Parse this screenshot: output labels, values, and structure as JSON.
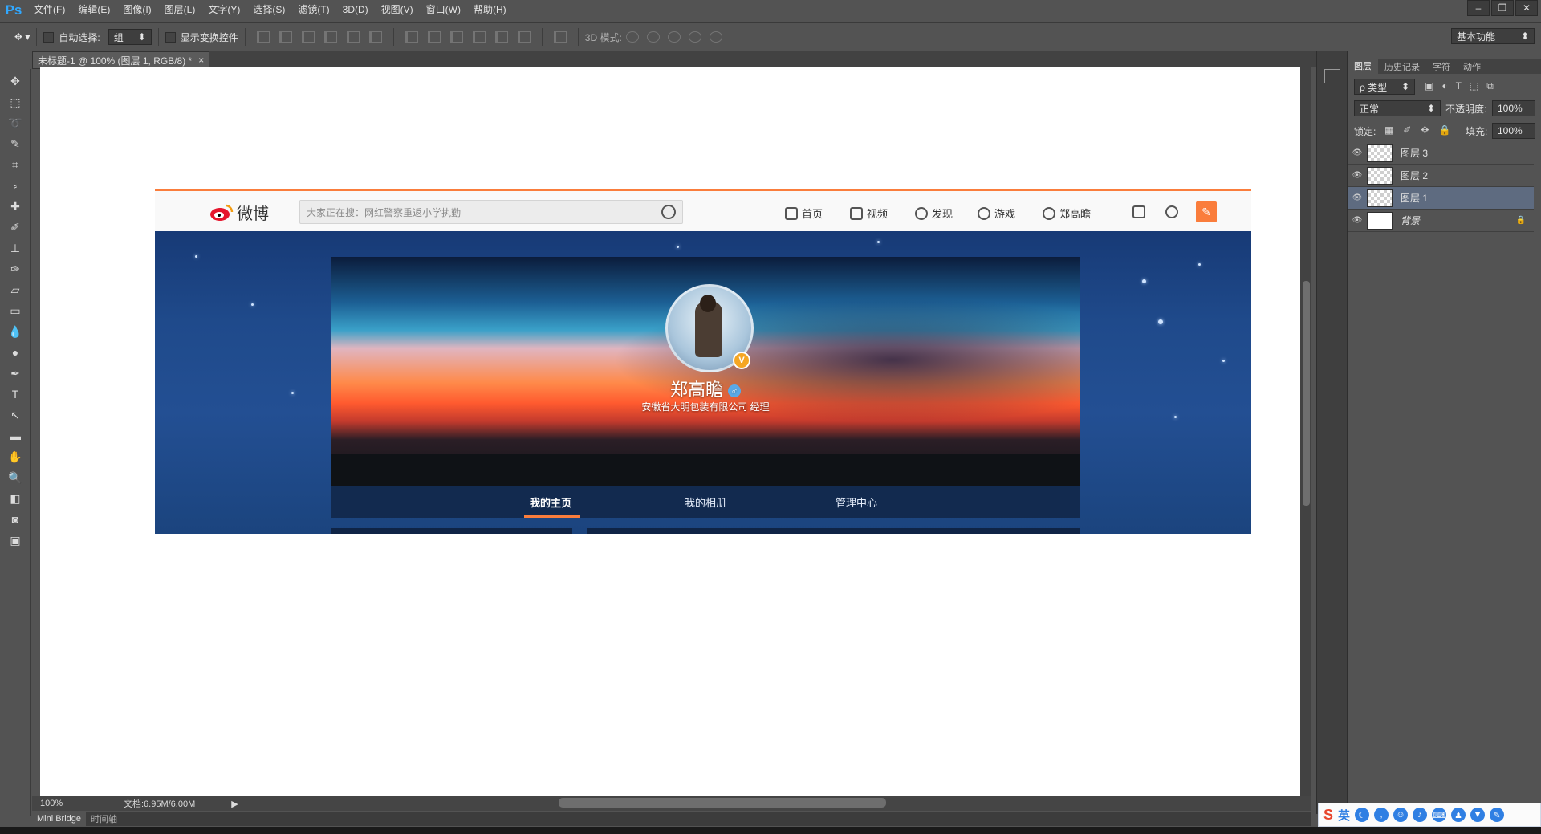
{
  "app": {
    "logo": "Ps"
  },
  "menu": [
    "文件(F)",
    "编辑(E)",
    "图像(I)",
    "图层(L)",
    "文字(Y)",
    "选择(S)",
    "滤镜(T)",
    "3D(D)",
    "视图(V)",
    "窗口(W)",
    "帮助(H)"
  ],
  "window_controls": {
    "minimize": "–",
    "restore": "❐",
    "close": "✕"
  },
  "options": {
    "auto_select_label": "自动选择:",
    "auto_select_value": "组",
    "show_transform_label": "显示变换控件",
    "mode_3d_label": "3D 模式:",
    "workspace_value": "基本功能"
  },
  "document": {
    "tab_title": "未标题-1 @ 100% (图层 1, RGB/8) *",
    "tab_close": "×",
    "zoom": "100%",
    "doc_size": "文档:6.95M/6.00M"
  },
  "bottom_tabs": [
    "Mini Bridge",
    "时间轴"
  ],
  "weibo": {
    "logo_text": "微博",
    "search_placeholder": "大家正在搜：网红警察重返小学执勤",
    "nav": [
      "首页",
      "视频",
      "发现",
      "游戏",
      "郑高瞻"
    ],
    "profile_name": "郑高瞻",
    "gender_symbol": "♂",
    "verify_symbol": "V",
    "profile_desc": "安徽省大明包装有限公司 经理",
    "tabs": [
      "我的主页",
      "我的相册",
      "管理中心"
    ]
  },
  "panels": {
    "tabs": [
      "图层",
      "历史记录",
      "字符",
      "动作"
    ],
    "filter_label": "ρ 类型",
    "blend_mode": "正常",
    "opacity_label": "不透明度:",
    "opacity_value": "100%",
    "lock_label": "锁定:",
    "fill_label": "填充:",
    "fill_value": "100%",
    "layers": [
      {
        "name": "图层 3",
        "selected": false
      },
      {
        "name": "图层 2",
        "selected": false
      },
      {
        "name": "图层 1",
        "selected": true
      },
      {
        "name": "背景",
        "selected": false
      }
    ]
  },
  "ime": {
    "logo": "S",
    "lang": "英"
  }
}
